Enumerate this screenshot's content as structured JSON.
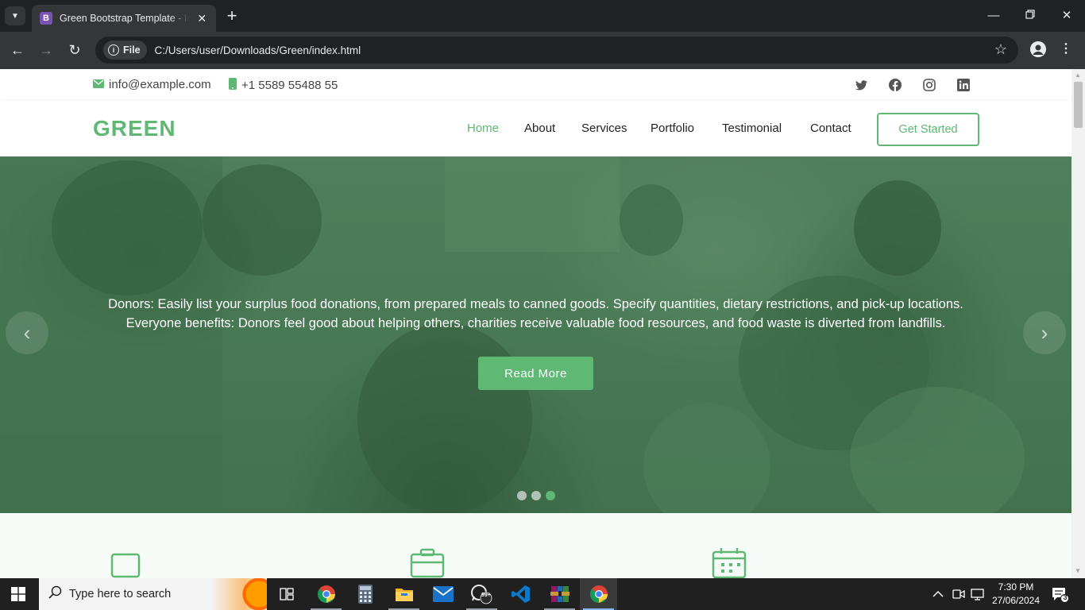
{
  "browser": {
    "tab_title": "Green Bootstrap Template - Index",
    "tab_favicon_letter": "B",
    "site_chip_label": "File",
    "url": "C:/Users/user/Downloads/Green/index.html"
  },
  "topbar": {
    "email": "info@example.com",
    "phone": "+1 5589 55488 55",
    "social_icons": [
      "twitter-icon",
      "facebook-icon",
      "instagram-icon",
      "linkedin-icon"
    ]
  },
  "header": {
    "logo": "GREEN",
    "nav": [
      {
        "label": "Home",
        "active": true
      },
      {
        "label": "About",
        "active": false
      },
      {
        "label": "Services",
        "active": false
      },
      {
        "label": "Portfolio",
        "active": false
      },
      {
        "label": "Testimonial",
        "active": false
      },
      {
        "label": "Contact",
        "active": false
      }
    ],
    "cta": "Get Started"
  },
  "hero": {
    "line1": "Donors: Easily list your surplus food donations, from prepared meals to canned goods. Specify quantities, dietary restrictions, and pick-up locations.",
    "line2": "Everyone benefits: Donors feel good about helping others, charities receive valuable food resources, and food waste is diverted from landfills.",
    "button": "Read More",
    "slide_count": 3,
    "active_slide": 3
  },
  "taskbar": {
    "search_placeholder": "Type here to search",
    "time": "7:30 PM",
    "date": "27/06/2024",
    "whatsapp_badge": "99+",
    "notification_count": "3"
  },
  "colors": {
    "accent": "#5fb874",
    "chrome_dark": "#202124",
    "chrome_toolbar": "#35363a"
  }
}
